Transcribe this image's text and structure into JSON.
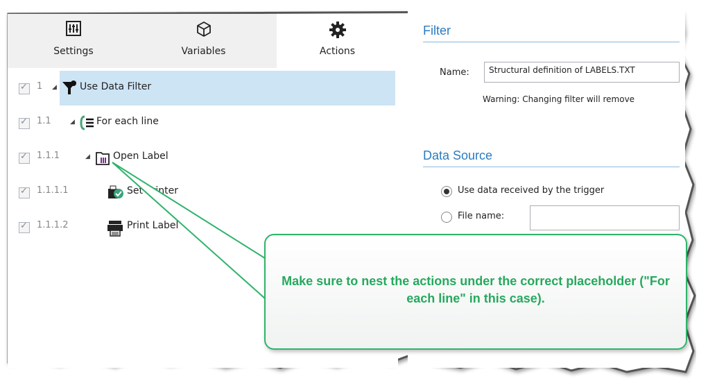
{
  "tabs": [
    {
      "label": "Settings",
      "icon": "sliders-icon",
      "active": false
    },
    {
      "label": "Variables",
      "icon": "cube-icon",
      "active": false
    },
    {
      "label": "Actions",
      "icon": "gear-icon",
      "active": true
    }
  ],
  "tree": [
    {
      "num": "1",
      "label": "Use Data Filter",
      "icon": "filter-icon",
      "selected": true
    },
    {
      "num": "1.1",
      "label": "For each line",
      "icon": "loop-icon"
    },
    {
      "num": "1.1.1",
      "label": "Open Label",
      "icon": "folder-label-icon"
    },
    {
      "num": "1.1.1.1",
      "label": "Set Printer",
      "icon": "printer-check-icon"
    },
    {
      "num": "1.1.1.2",
      "label": "Print Label",
      "icon": "printer-icon"
    }
  ],
  "filter": {
    "title": "Filter",
    "name_label": "Name:",
    "name_value": "Structural definition of LABELS.TXT",
    "warning": "Warning: Changing filter will remove"
  },
  "data_source": {
    "title": "Data Source",
    "option1": "Use data received by the trigger",
    "option2": "File name:",
    "selected": "option1"
  },
  "callout": {
    "text": "Make sure to nest the actions under the correct placeholder (\"For each line\" in this case)."
  },
  "colors": {
    "accent": "#2a7bc0",
    "callout_green": "#26a95e",
    "selection": "#cde4f5"
  }
}
